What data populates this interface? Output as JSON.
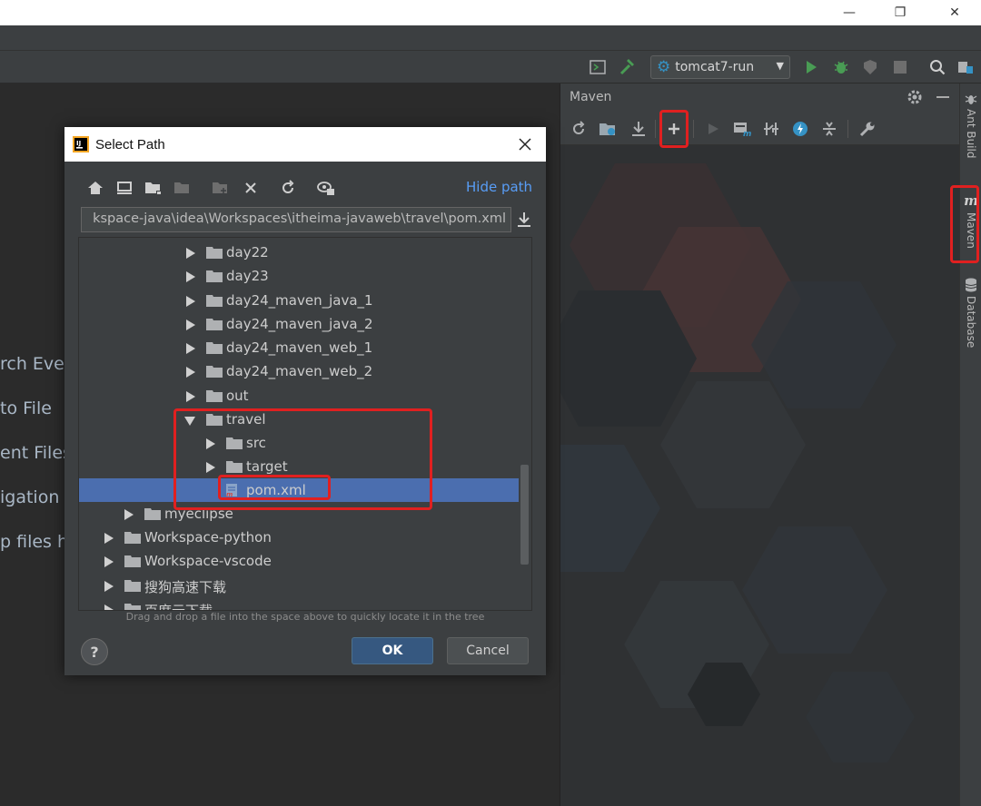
{
  "window": {
    "minimize": "—",
    "maximize": "❐",
    "close": "✕"
  },
  "toolbar": {
    "run_config": "tomcat7-run",
    "icons": [
      "run-config-icon",
      "build-hammer-icon",
      "gear-icon",
      "run-icon",
      "debug-icon",
      "coverage-icon",
      "stop-icon",
      "search-icon",
      "project-structure-icon"
    ]
  },
  "editor": {
    "welcome_lines": [
      "rch Ever",
      "to File",
      "ent Files",
      "igation",
      "p files h"
    ]
  },
  "maven": {
    "title": "Maven",
    "toolbar_icons": [
      "reload-icon",
      "reimport-folders-icon",
      "download-icon",
      "add-icon",
      "run-icon",
      "execute-goal-icon",
      "toggle-offline-icon",
      "skip-tests-icon",
      "collapse-all-icon",
      "settings-wrench-icon"
    ]
  },
  "right_strip": {
    "tabs": [
      "Ant Build",
      "Maven",
      "Database"
    ]
  },
  "dialog": {
    "title": "Select Path",
    "hide_path": "Hide path",
    "path": "C:\\Workspace-java\\idea\\Workspaces\\itheima-javaweb\\travel\\pom.xml",
    "path_visible": "kspace-java\\idea\\Workspaces\\itheima-javaweb\\travel\\pom.xml",
    "tree": [
      {
        "label": "day22",
        "state": "closed",
        "level": 2
      },
      {
        "label": "day23",
        "state": "closed",
        "level": 2
      },
      {
        "label": "day24_maven_java_1",
        "state": "closed",
        "level": 2
      },
      {
        "label": "day24_maven_java_2",
        "state": "closed",
        "level": 2
      },
      {
        "label": "day24_maven_web_1",
        "state": "closed",
        "level": 2
      },
      {
        "label": "day24_maven_web_2",
        "state": "closed",
        "level": 2
      },
      {
        "label": "out",
        "state": "closed",
        "level": 2
      },
      {
        "label": "travel",
        "state": "open",
        "level": 2
      },
      {
        "label": "src",
        "state": "closed",
        "level": 3
      },
      {
        "label": "target",
        "state": "closed",
        "level": 3
      },
      {
        "label": "pom.xml",
        "state": "file",
        "level": 3,
        "selected": true
      },
      {
        "label": "myeclipse",
        "state": "closed",
        "level": 1
      },
      {
        "label": "Workspace-python",
        "state": "closed",
        "level": 0
      },
      {
        "label": "Workspace-vscode",
        "state": "closed",
        "level": 0
      },
      {
        "label": "搜狗高速下载",
        "state": "closed",
        "level": 0
      },
      {
        "label": "百度云下载",
        "state": "closed",
        "level": 0
      }
    ],
    "drag_hint": "Drag and drop a file into the space above to quickly locate it in the tree",
    "help": "?",
    "ok": "OK",
    "cancel": "Cancel"
  },
  "colors": {
    "highlight": "#e02020",
    "selection": "#4b6eaf",
    "link": "#589df6",
    "ok_button": "#365880",
    "run_green": "#499c54"
  }
}
